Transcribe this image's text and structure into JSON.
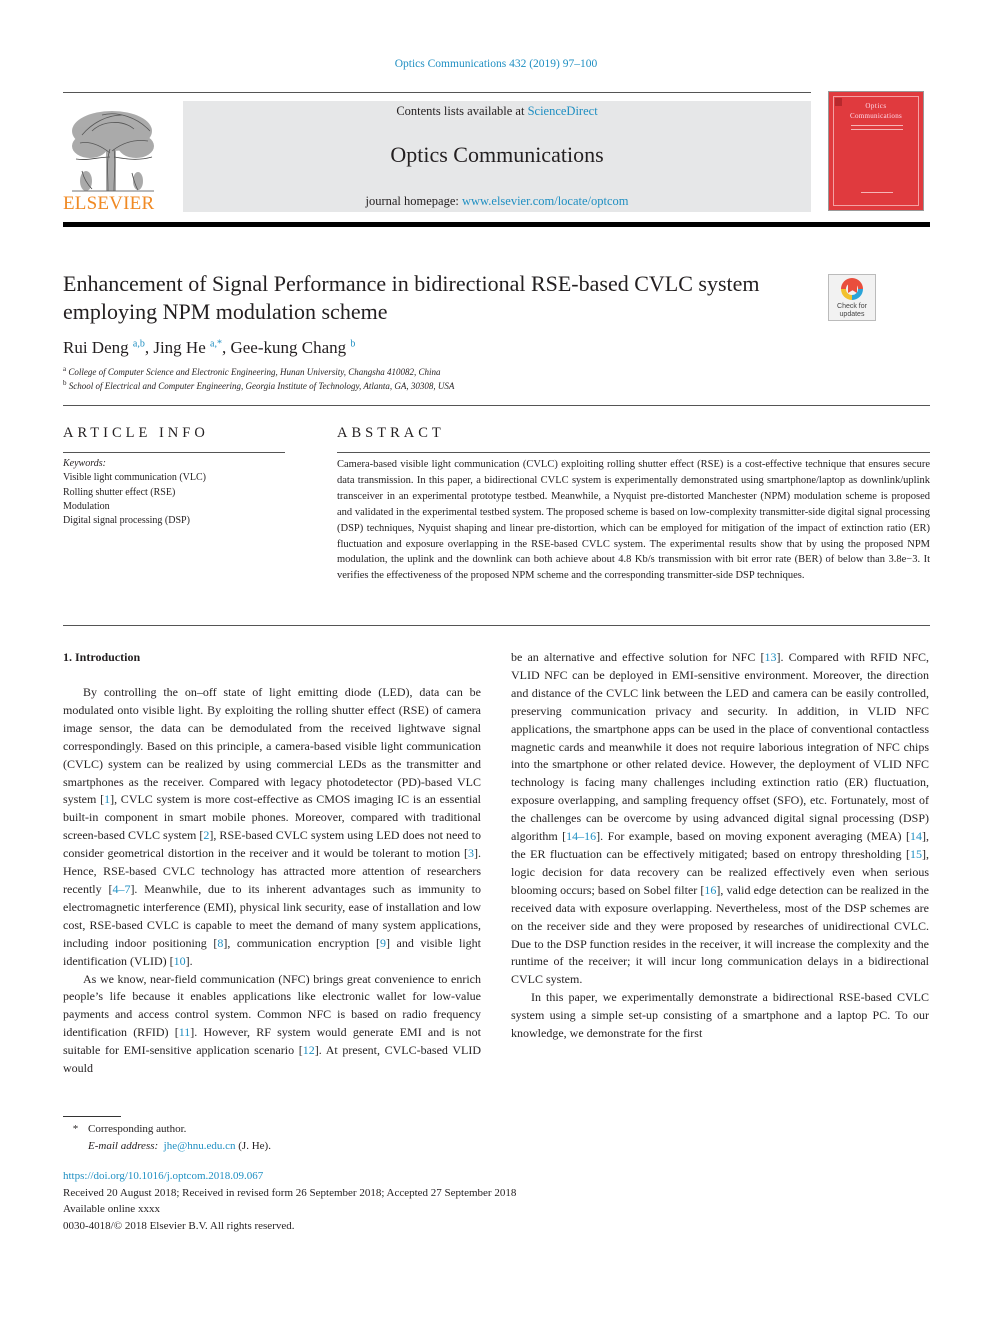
{
  "header": {
    "journal_ref": "Optics Communications 432 (2019) 97–100",
    "publisher_wordmark": "ELSEVIER",
    "contents_prefix": "Contents lists available at ",
    "contents_link": "ScienceDirect",
    "journal_name": "Optics Communications",
    "homepage_prefix": "journal homepage: ",
    "homepage_link": "www.elsevier.com/locate/optcom",
    "cover_title_line1": "Optics",
    "cover_title_line2": "Communications",
    "crossmark_label_line1": "Check for",
    "crossmark_label_line2": "updates",
    "colors": {
      "link": "#1f8fc2",
      "elsevier_orange": "#f08a24",
      "cover_red": "#e03a3e",
      "masthead_gray": "#e6e7e8"
    }
  },
  "article": {
    "title": "Enhancement of Signal Performance in bidirectional RSE-based CVLC system employing NPM modulation scheme",
    "authors": [
      {
        "name": "Rui Deng",
        "sup": "a,b",
        "sep": ", "
      },
      {
        "name": "Jing He",
        "sup": "a,*",
        "sep": ", "
      },
      {
        "name": "Gee-kung Chang",
        "sup": "b",
        "sep": ""
      }
    ],
    "affiliations": [
      {
        "mark": "a",
        "text": "College of Computer Science and Electronic Engineering, Hunan University, Changsha  410082, China"
      },
      {
        "mark": "b",
        "text": "School of Electrical and Computer Engineering, Georgia Institute of Technology, Atlanta, GA, 30308, USA"
      }
    ]
  },
  "article_info": {
    "heading": "ARTICLE INFO",
    "keywords_label": "Keywords:",
    "keywords": [
      "Visible light communication (VLC)",
      "Rolling shutter effect (RSE)",
      "Modulation",
      "Digital signal processing (DSP)"
    ]
  },
  "abstract": {
    "heading": "ABSTRACT",
    "text": "Camera-based visible light communication (CVLC) exploiting rolling shutter effect (RSE) is a cost-effective technique that ensures secure data transmission. In this paper, a bidirectional CVLC system is experimentally demonstrated using smartphone/laptop as downlink/uplink transceiver in an experimental prototype testbed. Meanwhile, a Nyquist pre-distorted Manchester (NPM) modulation scheme is proposed and validated in the experimental testbed system. The proposed scheme is based on low-complexity transmitter-side digital signal processing (DSP) techniques, Nyquist shaping and linear pre-distortion, which can be employed for mitigation of the impact of extinction ratio (ER) fluctuation and exposure overlapping in the RSE-based CVLC system. The experimental results show that by using the proposed NPM modulation, the uplink and the downlink can both achieve about 4.8 Kb/s transmission with bit error rate (BER) of below than 3.8e−3. It verifies the effectiveness of the proposed NPM scheme and the corresponding transmitter-side DSP techniques."
  },
  "introduction": {
    "heading": "1.  Introduction",
    "left_paragraphs": [
      [
        {
          "t": "By controlling the on–off state of light emitting diode (LED), data can be modulated onto visible light. By exploiting the rolling shutter effect (RSE) of camera image sensor, the data can be demodulated from the received lightwave signal correspondingly. Based on this principle, a camera-based visible light communication (CVLC) system can be realized by using commercial LEDs as the transmitter and smartphones as the receiver. Compared with legacy photodetector (PD)-based VLC system ["
        },
        {
          "t": "1",
          "ref": true
        },
        {
          "t": "], CVLC system is more cost-effective as CMOS imaging IC is an essential built-in component in smart mobile phones. Moreover, compared with traditional screen-based CVLC system ["
        },
        {
          "t": "2",
          "ref": true
        },
        {
          "t": "], RSE-based CVLC system using LED does not need to consider geometrical distortion in the receiver and it would be tolerant to motion ["
        },
        {
          "t": "3",
          "ref": true
        },
        {
          "t": "]. Hence, RSE-based CVLC technology has attracted more attention of researchers recently ["
        },
        {
          "t": "4–7",
          "ref": true
        },
        {
          "t": "]. Meanwhile, due to its inherent advantages such as immunity to electromagnetic interference (EMI), physical link security, ease of installation and low cost, RSE-based CVLC is capable to meet the demand of many system applications, including indoor positioning ["
        },
        {
          "t": "8",
          "ref": true
        },
        {
          "t": "], communication encryption ["
        },
        {
          "t": "9",
          "ref": true
        },
        {
          "t": "] and visible light identification (VLID) ["
        },
        {
          "t": "10",
          "ref": true
        },
        {
          "t": "]."
        }
      ],
      [
        {
          "t": "As we know, near-field communication (NFC) brings great convenience to enrich people’s life because it enables applications like electronic wallet for low-value payments and access control system. Common NFC is based on radio frequency identification (RFID) ["
        },
        {
          "t": "11",
          "ref": true
        },
        {
          "t": "]. However, RF system would generate EMI and is not suitable for EMI-sensitive application scenario ["
        },
        {
          "t": "12",
          "ref": true
        },
        {
          "t": "]. At present, CVLC-based VLID would"
        }
      ]
    ],
    "right_paragraphs": [
      [
        {
          "t": "be an alternative and effective solution for NFC ["
        },
        {
          "t": "13",
          "ref": true
        },
        {
          "t": "]. Compared with RFID NFC, VLID NFC can be deployed in EMI-sensitive environment. Moreover, the direction and distance of the CVLC link between the LED and camera can be easily controlled, preserving communication privacy and security. In addition, in VLID NFC applications, the smartphone apps can be used in the place of conventional contactless magnetic cards and meanwhile it does not require laborious integration of NFC chips into the smartphone or other related device. However, the deployment of VLID NFC technology is facing many challenges including extinction ratio (ER) fluctuation, exposure overlapping, and sampling frequency offset (SFO), etc. Fortunately, most of the challenges can be overcome by using advanced digital signal processing (DSP) algorithm ["
        },
        {
          "t": "14–16",
          "ref": true
        },
        {
          "t": "]. For example, based on moving exponent averaging (MEA) ["
        },
        {
          "t": "14",
          "ref": true
        },
        {
          "t": "], the ER fluctuation can be effectively mitigated; based on entropy thresholding ["
        },
        {
          "t": "15",
          "ref": true
        },
        {
          "t": "], logic decision for data recovery can be realized effectively even when serious blooming occurs; based on Sobel filter ["
        },
        {
          "t": "16",
          "ref": true
        },
        {
          "t": "], valid edge detection can be realized in the received data with exposure overlapping. Nevertheless, most of the DSP schemes are on the receiver side and they were proposed by researches of unidirectional CVLC. Due to the DSP function resides in the receiver, it will increase the complexity and the runtime of the receiver; it will incur long communication delays in a bidirectional CVLC system."
        }
      ],
      [
        {
          "t": "In this paper, we experimentally demonstrate a bidirectional RSE-based CVLC system using a simple set-up consisting of a smartphone and a laptop PC. To our knowledge, we demonstrate for the first"
        }
      ]
    ]
  },
  "footnotes": {
    "star": "*",
    "corresponding": "Corresponding author.",
    "email_label": "E-mail address:",
    "email": "jhe@hnu.edu.cn",
    "email_suffix": " (J. He)."
  },
  "meta": {
    "doi": "https://doi.org/10.1016/j.optcom.2018.09.067",
    "received": "Received 20 August 2018; Received in revised form 26 September 2018; Accepted 27 September 2018",
    "available": "Available online  xxxx",
    "copyright": "0030-4018/© 2018 Elsevier B.V. All rights reserved."
  }
}
